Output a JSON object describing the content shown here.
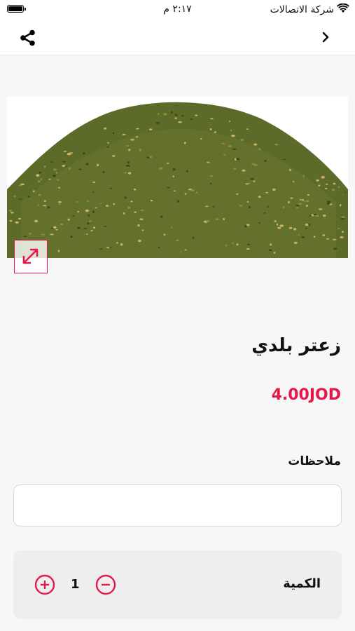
{
  "status_bar": {
    "carrier": "شركة الاتصالات",
    "time": "٢:١٧ م"
  },
  "nav": {
    "share_icon": "share-icon",
    "back_icon": "chevron-right-icon"
  },
  "product": {
    "title": "زعتر بلدي",
    "price": "4.00JOD",
    "expand_icon": "expand-icon"
  },
  "notes": {
    "label": "ملاحظات",
    "value": "",
    "placeholder": ""
  },
  "quantity": {
    "label": "الكمية",
    "value": "1"
  },
  "colors": {
    "accent": "#e8174a",
    "background": "#f7f7f7",
    "zaatar_green": "#5d6b2a",
    "sesame": "#c9b25a"
  }
}
